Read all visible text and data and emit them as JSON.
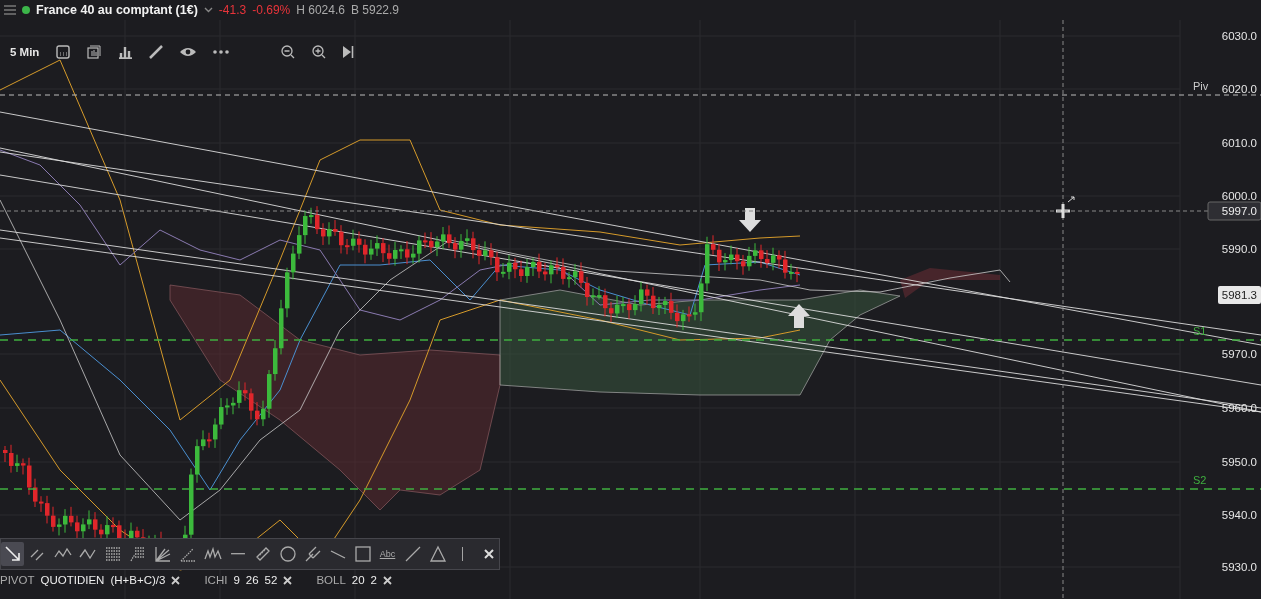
{
  "header": {
    "instrument": "France 40 au comptant (1€)",
    "change": "-41.3",
    "change_pct": "-0.69%",
    "high": "H 6024.6",
    "low": "B 5922.9"
  },
  "chart_toolbar": {
    "timeframe": "5 Min"
  },
  "price_axis": {
    "ticks": [
      "6030.0",
      "6020.0",
      "6010.0",
      "6000.0",
      "5990.0",
      "5970.0",
      "5960.0",
      "5950.0",
      "5940.0",
      "5930.0"
    ]
  },
  "levels": [
    {
      "label": "Piv",
      "kind": "pivot"
    },
    {
      "label": "S1",
      "kind": "support"
    },
    {
      "label": "S2",
      "kind": "support"
    }
  ],
  "price_tags": [
    {
      "value": "5997.0",
      "kind": "cursor"
    },
    {
      "value": "5981.3",
      "kind": "last"
    }
  ],
  "drawing_tools": [
    {
      "kind": "arrow",
      "selected": true
    },
    {
      "kind": "parallel",
      "selected": false
    },
    {
      "kind": "wave",
      "selected": false
    },
    {
      "kind": "zigzag",
      "selected": false
    },
    {
      "kind": "grid",
      "selected": false
    },
    {
      "kind": "fib",
      "selected": false
    },
    {
      "kind": "fan",
      "selected": false
    },
    {
      "kind": "angle",
      "selected": false
    },
    {
      "kind": "pattern",
      "selected": false
    },
    {
      "kind": "hline",
      "selected": false
    },
    {
      "kind": "ruler",
      "selected": false
    },
    {
      "kind": "circle",
      "selected": false
    },
    {
      "kind": "pitchfork",
      "selected": false
    },
    {
      "kind": "segment",
      "selected": false
    },
    {
      "kind": "rect",
      "selected": false
    },
    {
      "kind": "text",
      "label": "Abc",
      "selected": false
    },
    {
      "kind": "line",
      "selected": false
    },
    {
      "kind": "triangle",
      "selected": false
    },
    {
      "kind": "vline",
      "selected": false
    }
  ],
  "indicators": [
    {
      "name": "PIVOT",
      "params": [
        "QUOTIDIEN",
        "(H+B+C)/3"
      ]
    },
    {
      "name": "ICHI",
      "params": [
        "9",
        "26",
        "52"
      ]
    },
    {
      "name": "BOLL",
      "params": [
        "20",
        "2"
      ]
    }
  ]
}
